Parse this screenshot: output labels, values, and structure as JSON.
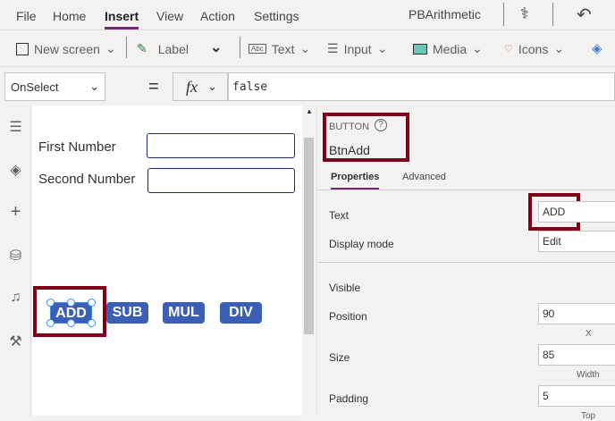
{
  "menu": {
    "items": [
      "File",
      "Home",
      "Insert",
      "View",
      "Action",
      "Settings"
    ],
    "active": "Insert",
    "app_name": "PBArithmetic"
  },
  "toolbar": {
    "new_screen": "New screen",
    "label": "Label",
    "text": "Text",
    "input": "Input",
    "media": "Media",
    "icons": "Icons"
  },
  "formula": {
    "property": "OnSelect",
    "equals": "=",
    "fx": "fx",
    "value": "false"
  },
  "canvas": {
    "first_label": "First Number",
    "second_label": "Second Number",
    "first_value": "",
    "second_value": "",
    "buttons": [
      "ADD",
      "SUB",
      "MUL",
      "DIV"
    ]
  },
  "panel": {
    "type": "BUTTON",
    "name": "BtnAdd",
    "tabs": [
      "Properties",
      "Advanced"
    ],
    "text_label": "Text",
    "text_value": "ADD",
    "display_label": "Display mode",
    "display_value": "Edit",
    "visible_label": "Visible",
    "position_label": "Position",
    "position_x": "90",
    "x_label": "X",
    "size_label": "Size",
    "size_width": "85",
    "width_label": "Width",
    "padding_label": "Padding",
    "padding_top": "5",
    "top_label": "Top"
  },
  "colors": {
    "accent": "#742774",
    "button": "#3a5fb4",
    "highlight": "#800017"
  }
}
